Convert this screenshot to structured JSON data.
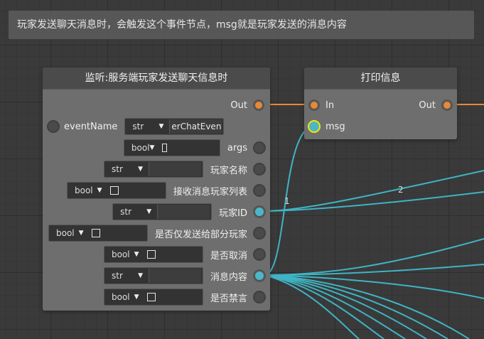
{
  "comment": {
    "text": "玩家发送聊天消息时，会触发这个事件节点，msg就是玩家发送的消息内容"
  },
  "node_listen": {
    "title": "监听:服务端玩家发送聊天信息时",
    "out_label": "Out",
    "event_name_label": "eventName",
    "event_name_type": "str",
    "event_name_value": "erChatEvent",
    "params": [
      {
        "label": "args",
        "type": "bool"
      },
      {
        "label": "玩家名称",
        "type": "str"
      },
      {
        "label": "接收消息玩家列表",
        "type": "bool"
      },
      {
        "label": "玩家ID",
        "type": "str"
      },
      {
        "label": "是否仅发送给部分玩家",
        "type": "bool"
      },
      {
        "label": "是否取消",
        "type": "bool"
      },
      {
        "label": "消息内容",
        "type": "str"
      },
      {
        "label": "是否禁言",
        "type": "bool"
      }
    ]
  },
  "node_print": {
    "title": "打印信息",
    "in_label": "In",
    "out_label": "Out",
    "msg_label": "msg"
  },
  "wire_labels": {
    "one": "1",
    "two": "2"
  },
  "colors": {
    "exec_wire": "#e88838",
    "data_wire": "#3fb4c4",
    "selected_pin": "#f2e600"
  }
}
